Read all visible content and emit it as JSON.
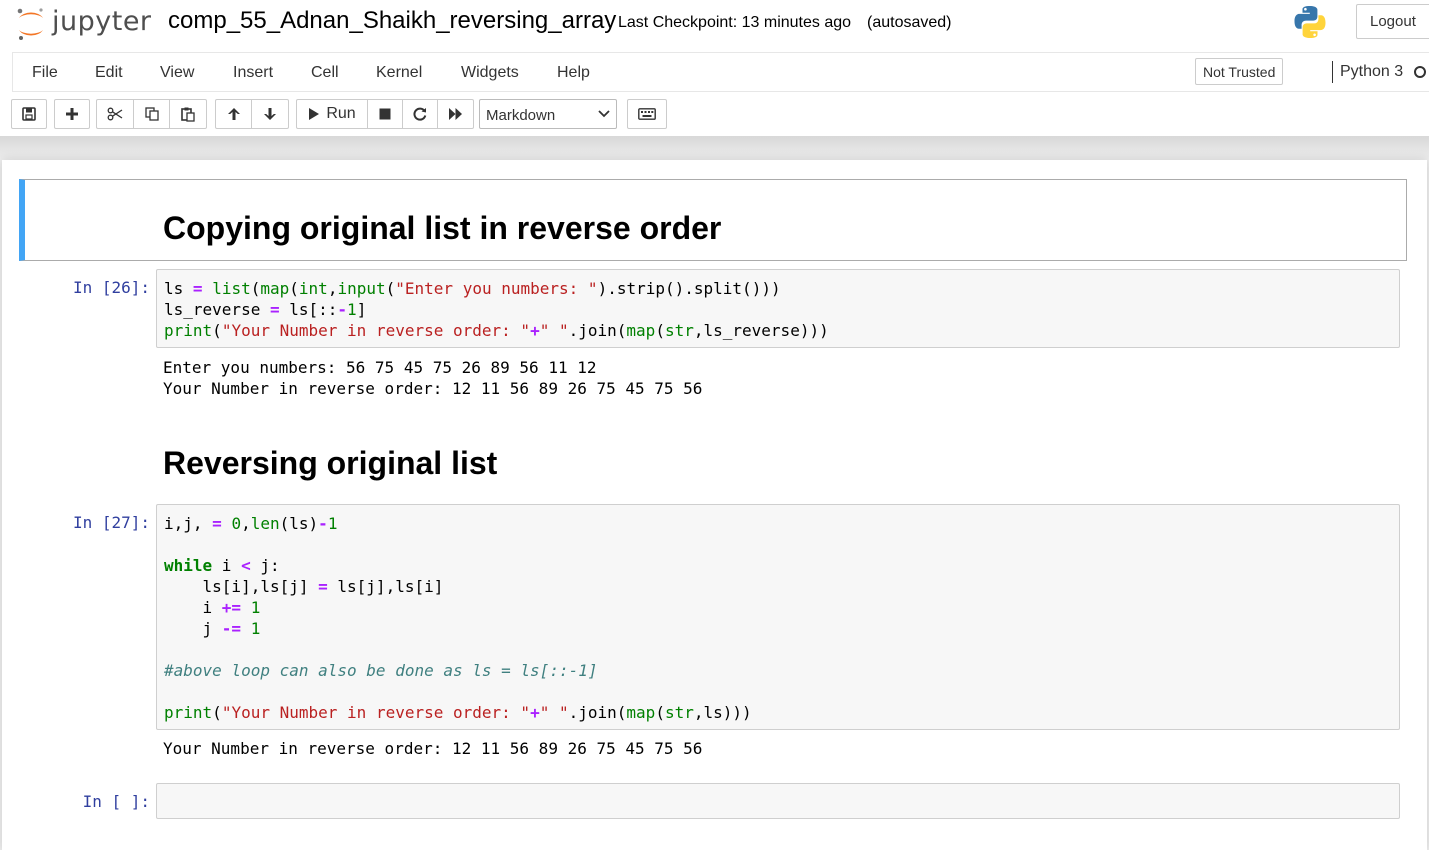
{
  "header": {
    "logo_text": "jupyter",
    "notebook_name": "comp_55_Adnan_Shaikh_reversing_array",
    "checkpoint": "Last Checkpoint: 13 minutes ago",
    "autosave_status": "(autosaved)",
    "logout_label": "Logout"
  },
  "menubar": {
    "items": [
      "File",
      "Edit",
      "View",
      "Insert",
      "Cell",
      "Kernel",
      "Widgets",
      "Help"
    ],
    "trust_label": "Not Trusted",
    "kernel_name": "Python 3"
  },
  "toolbar": {
    "run_label": "Run",
    "cell_type": "Markdown",
    "icons": [
      "save-icon",
      "plus-icon",
      "scissors-icon",
      "copy-icon",
      "paste-icon",
      "arrow-up-icon",
      "arrow-down-icon",
      "play-icon",
      "stop-icon",
      "restart-icon",
      "fast-forward-icon",
      "chevron-down-icon",
      "keyboard-icon"
    ]
  },
  "cells": {
    "md1": {
      "text": "Copying original list in reverse order"
    },
    "code1": {
      "prompt": "In [26]:",
      "output_lines": [
        "Enter you numbers: 56 75 45 75 26 89 56 11 12",
        "Your Number in reverse order: 12 11 56 89 26 75 45 75 56"
      ]
    },
    "md2": {
      "text": "Reversing original list"
    },
    "code2": {
      "prompt": "In [27]:",
      "output_lines": [
        "Your Number in reverse order: 12 11 56 89 26 75 45 75 56"
      ]
    },
    "code3": {
      "prompt": "In [ ]:"
    }
  },
  "colors": {
    "selected_cell_accent": "#42a5f5",
    "prompt_color": "#303f9f",
    "logo_orange": "#f37626",
    "python_blue": "#3776ab",
    "python_yellow": "#ffd43b"
  }
}
